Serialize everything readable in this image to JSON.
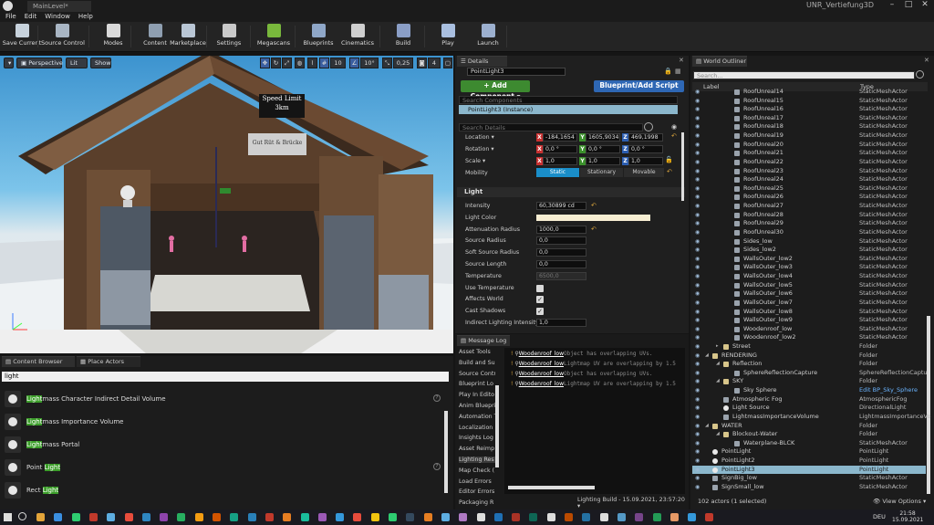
{
  "window": {
    "tab_title": "MainLevel*",
    "project_name": "UNR_Vertiefung3D",
    "minimize": "–",
    "maximize": "□",
    "close": "✕"
  },
  "menu": [
    "File",
    "Edit",
    "Window",
    "Help"
  ],
  "toolbar": [
    {
      "label": "Save Current",
      "icon": "save-icon",
      "color": "#c7d2dc"
    },
    {
      "label": "Source Control",
      "icon": "source-control-icon",
      "color": "#a9b6c4"
    },
    {
      "label": "Modes",
      "icon": "modes-icon",
      "color": "#d9d9d9"
    },
    {
      "label": "Content",
      "icon": "content-icon",
      "color": "#8f9fb1"
    },
    {
      "label": "Marketplace",
      "icon": "marketplace-icon",
      "color": "#b9c6d5"
    },
    {
      "label": "Settings",
      "icon": "settings-icon",
      "color": "#c9c9c9"
    },
    {
      "label": "Megascans",
      "icon": "megascans-icon",
      "color": "#79b83c"
    },
    {
      "label": "Blueprints",
      "icon": "blueprints-icon",
      "color": "#8fa7c8"
    },
    {
      "label": "Cinematics",
      "icon": "cinematics-icon",
      "color": "#cfcfcf"
    },
    {
      "label": "Build",
      "icon": "build-icon",
      "color": "#8a9ec6"
    },
    {
      "label": "Play",
      "icon": "play-icon",
      "color": "#a9bfe0"
    },
    {
      "label": "Launch",
      "icon": "launch-icon",
      "color": "#9cb0cf"
    }
  ],
  "viewport": {
    "perspective": "Perspective",
    "lit": "Lit",
    "show": "Show",
    "snap_grid": "10",
    "snap_rot": "10°",
    "snap_scale": "0,25",
    "camera_speed": "4",
    "sign_top": "Speed Limit",
    "sign_top_sub": "3km",
    "sign_mid": "Gut Rüt & Brücke"
  },
  "content_browser": {
    "tab": "Content Browser",
    "tab2": "Place Actors",
    "search": "light",
    "items": [
      {
        "pre": "",
        "hl": "Light",
        "post": "mass Character Indirect Detail Volume",
        "help": true
      },
      {
        "pre": "",
        "hl": "Light",
        "post": "mass Importance Volume",
        "help": false
      },
      {
        "pre": "",
        "hl": "Light",
        "post": "mass Portal",
        "help": false
      },
      {
        "pre": "Point ",
        "hl": "Light",
        "post": "",
        "help": true
      },
      {
        "pre": "Rect ",
        "hl": "Light",
        "post": "",
        "help": false
      }
    ]
  },
  "details": {
    "tab": "Details",
    "name": "PointLight3",
    "add_component": "+ Add Component ▾",
    "blueprint": "Blueprint/Add Script",
    "search_components": "Search Components",
    "instance": "PointLight3 (Instance)",
    "search_details": "Search Details",
    "location": {
      "label": "Location ▾",
      "x": "-184,1654",
      "y": "1605,9034",
      "z": "469,1998"
    },
    "rotation": {
      "label": "Rotation ▾",
      "x": "0,0 °",
      "y": "0,0 °",
      "z": "0,0 °"
    },
    "scale": {
      "label": "Scale ▾",
      "x": "1,0",
      "y": "1,0",
      "z": "1,0"
    },
    "mobility": {
      "label": "Mobility",
      "static": "Static",
      "stationary": "Stationary",
      "movable": "Movable"
    },
    "section": "Light",
    "props": [
      {
        "label": "Intensity",
        "value": "60,30899 cd",
        "kind": "num"
      },
      {
        "label": "Light Color",
        "value": "",
        "kind": "color"
      },
      {
        "label": "Attenuation Radius",
        "value": "1000,0",
        "kind": "num"
      },
      {
        "label": "Source Radius",
        "value": "0,0",
        "kind": "num"
      },
      {
        "label": "Soft Source Radius",
        "value": "0,0",
        "kind": "num"
      },
      {
        "label": "Source Length",
        "value": "0,0",
        "kind": "num"
      },
      {
        "label": "Temperature",
        "value": "6500,0",
        "kind": "num-dim"
      },
      {
        "label": "Use Temperature",
        "value": "",
        "kind": "unchecked"
      },
      {
        "label": "Affects World",
        "value": "✓",
        "kind": "checked"
      },
      {
        "label": "Cast Shadows",
        "value": "✓",
        "kind": "checked"
      },
      {
        "label": "Indirect Lighting Intensity",
        "value": "1,0",
        "kind": "num"
      }
    ],
    "light_color_hex": "#f7eed2"
  },
  "message_log": {
    "tab": "Message Log",
    "categories": [
      "Asset Tools",
      "Build and Su",
      "Source Contr",
      "Blueprint Lo",
      "Play In Edito",
      "Anim Bluepri",
      "Automation T",
      "Localization",
      "Insights Log",
      "Asset Reimp",
      "Lighting Res",
      "Map Check (",
      "Load Errors",
      "Editor Errors",
      "Packaging R"
    ],
    "selected_category": "Lighting Res",
    "lines": [
      {
        "name": "Woodenroof_low",
        "rest": "Object has overlapping UVs."
      },
      {
        "name": "Woodenroof_low",
        "rest": "Lightmap UV are overlapping by 1.5"
      },
      {
        "name": "Woodenroof_low",
        "rest": "Object has overlapping UVs."
      },
      {
        "name": "Woodenroof_low",
        "rest": "Lightmap UV are overlapping by 1.5"
      }
    ],
    "footer": "Lighting Build - 15.09.2021, 23:57:20 ▾"
  },
  "outliner": {
    "tab": "World Outliner",
    "search": "Search...",
    "col_label": "Label",
    "col_type": "Type",
    "footer_count": "102 actors (1 selected)",
    "footer_view": "👁 View Options ▾",
    "rows": [
      {
        "name": "RoofUnreal14",
        "type": "StaticMeshActor",
        "indent": 46,
        "kind": "mesh"
      },
      {
        "name": "RoofUnreal15",
        "type": "StaticMeshActor",
        "indent": 46,
        "kind": "mesh"
      },
      {
        "name": "RoofUnreal16",
        "type": "StaticMeshActor",
        "indent": 46,
        "kind": "mesh"
      },
      {
        "name": "RoofUnreal17",
        "type": "StaticMeshActor",
        "indent": 46,
        "kind": "mesh"
      },
      {
        "name": "RoofUnreal18",
        "type": "StaticMeshActor",
        "indent": 46,
        "kind": "mesh"
      },
      {
        "name": "RoofUnreal19",
        "type": "StaticMeshActor",
        "indent": 46,
        "kind": "mesh"
      },
      {
        "name": "RoofUnreal20",
        "type": "StaticMeshActor",
        "indent": 46,
        "kind": "mesh"
      },
      {
        "name": "RoofUnreal21",
        "type": "StaticMeshActor",
        "indent": 46,
        "kind": "mesh"
      },
      {
        "name": "RoofUnreal22",
        "type": "StaticMeshActor",
        "indent": 46,
        "kind": "mesh"
      },
      {
        "name": "RoofUnreal23",
        "type": "StaticMeshActor",
        "indent": 46,
        "kind": "mesh"
      },
      {
        "name": "RoofUnreal24",
        "type": "StaticMeshActor",
        "indent": 46,
        "kind": "mesh"
      },
      {
        "name": "RoofUnreal25",
        "type": "StaticMeshActor",
        "indent": 46,
        "kind": "mesh"
      },
      {
        "name": "RoofUnreal26",
        "type": "StaticMeshActor",
        "indent": 46,
        "kind": "mesh"
      },
      {
        "name": "RoofUnreal27",
        "type": "StaticMeshActor",
        "indent": 46,
        "kind": "mesh"
      },
      {
        "name": "RoofUnreal28",
        "type": "StaticMeshActor",
        "indent": 46,
        "kind": "mesh"
      },
      {
        "name": "RoofUnreal29",
        "type": "StaticMeshActor",
        "indent": 46,
        "kind": "mesh"
      },
      {
        "name": "RoofUnreal30",
        "type": "StaticMeshActor",
        "indent": 46,
        "kind": "mesh"
      },
      {
        "name": "Sides_low",
        "type": "StaticMeshActor",
        "indent": 46,
        "kind": "mesh"
      },
      {
        "name": "Sides_low2",
        "type": "StaticMeshActor",
        "indent": 46,
        "kind": "mesh"
      },
      {
        "name": "WallsOuter_low2",
        "type": "StaticMeshActor",
        "indent": 46,
        "kind": "mesh"
      },
      {
        "name": "WallsOuter_low3",
        "type": "StaticMeshActor",
        "indent": 46,
        "kind": "mesh"
      },
      {
        "name": "WallsOuter_low4",
        "type": "StaticMeshActor",
        "indent": 46,
        "kind": "mesh"
      },
      {
        "name": "WallsOuter_low5",
        "type": "StaticMeshActor",
        "indent": 46,
        "kind": "mesh"
      },
      {
        "name": "WallsOuter_low6",
        "type": "StaticMeshActor",
        "indent": 46,
        "kind": "mesh"
      },
      {
        "name": "WallsOuter_low7",
        "type": "StaticMeshActor",
        "indent": 46,
        "kind": "mesh"
      },
      {
        "name": "WallsOuter_low8",
        "type": "StaticMeshActor",
        "indent": 46,
        "kind": "mesh"
      },
      {
        "name": "WallsOuter_low9",
        "type": "StaticMeshActor",
        "indent": 46,
        "kind": "mesh"
      },
      {
        "name": "Woodenroof_low",
        "type": "StaticMeshActor",
        "indent": 46,
        "kind": "mesh"
      },
      {
        "name": "Woodenroof_low2",
        "type": "StaticMeshActor",
        "indent": 46,
        "kind": "mesh"
      },
      {
        "name": "Street",
        "type": "Folder",
        "indent": 34,
        "kind": "folder",
        "arrow": "▸"
      },
      {
        "name": "RENDERING",
        "type": "Folder",
        "indent": 22,
        "kind": "folder",
        "arrow": "◢"
      },
      {
        "name": "Reflection",
        "type": "Folder",
        "indent": 34,
        "kind": "folder",
        "arrow": "◢"
      },
      {
        "name": "SphereReflectionCapture",
        "type": "SphereReflectionCaptu",
        "indent": 46,
        "kind": "actor"
      },
      {
        "name": "SKY",
        "type": "Folder",
        "indent": 34,
        "kind": "folder",
        "arrow": "◢"
      },
      {
        "name": "Sky Sphere",
        "type": "Edit BP_Sky_Sphere",
        "indent": 46,
        "kind": "actor",
        "link": true
      },
      {
        "name": "Atmospheric Fog",
        "type": "AtmosphericFog",
        "indent": 34,
        "kind": "actor"
      },
      {
        "name": "Light Source",
        "type": "DirectionalLight",
        "indent": 34,
        "kind": "light"
      },
      {
        "name": "LightmassImportanceVolume",
        "type": "LightmassImportanceVo",
        "indent": 34,
        "kind": "actor"
      },
      {
        "name": "WATER",
        "type": "Folder",
        "indent": 22,
        "kind": "folder",
        "arrow": "◢"
      },
      {
        "name": "Blockout-Water",
        "type": "Folder",
        "indent": 34,
        "kind": "folder",
        "arrow": "◢"
      },
      {
        "name": "Waterplane-BLCK",
        "type": "StaticMeshActor",
        "indent": 46,
        "kind": "mesh"
      },
      {
        "name": "PointLight",
        "type": "PointLight",
        "indent": 22,
        "kind": "light"
      },
      {
        "name": "PointLight2",
        "type": "PointLight",
        "indent": 22,
        "kind": "light"
      },
      {
        "name": "PointLight3",
        "type": "PointLight",
        "indent": 22,
        "kind": "light",
        "selected": true
      },
      {
        "name": "SignBig_low",
        "type": "StaticMeshActor",
        "indent": 22,
        "kind": "mesh"
      },
      {
        "name": "SignSmall_low",
        "type": "StaticMeshActor",
        "indent": 22,
        "kind": "mesh"
      }
    ]
  },
  "taskbar": {
    "lang": "DEU",
    "time": "21:58",
    "date": "15.09.2021"
  }
}
